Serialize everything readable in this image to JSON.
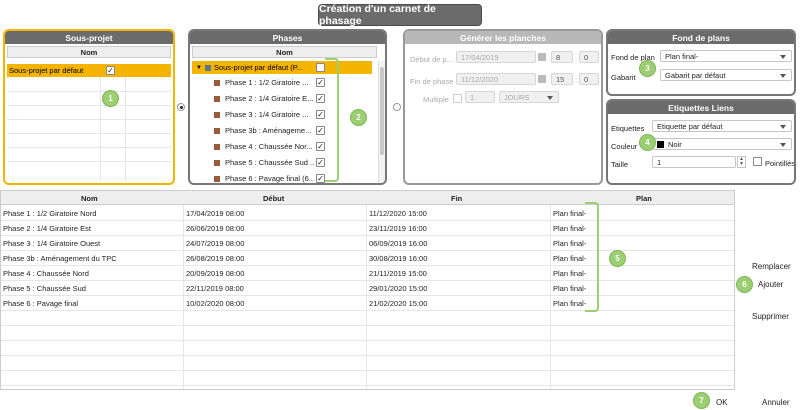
{
  "title": "Création d'un carnet de phasage",
  "sous_projet": {
    "title": "Sous-projet",
    "col_nom": "Nom",
    "rows": [
      {
        "label": "Sous-projet par défaut",
        "checked": true
      }
    ]
  },
  "phases": {
    "title": "Phases",
    "col_nom": "Nom",
    "parent": "Sous-projet par défaut (P...",
    "items": [
      "Phase 1 : 1/2 Giratoire ...",
      "Phase 2 : 1/4 Giratoire E...",
      "Phase 3 : 1/4 Giratoire ...",
      "Phase 3b : Aménageme...",
      "Phase 4 : Chaussée Nor...",
      "Phase 5 : Chaussée Sud ...",
      "Phase 6 : Pavage final (6..."
    ]
  },
  "generer": {
    "title": "Générer les planches",
    "debut_label": "Début de p...",
    "debut_date": "17/04/2019",
    "debut_h": "8",
    "debut_m": "0",
    "fin_label": "Fin de phase",
    "fin_date": "11/12/2020",
    "fin_h": "15",
    "fin_m": "0",
    "multiple_label": "Multiple",
    "multiple_value": "1",
    "unit": "JOURS"
  },
  "fond": {
    "title": "Fond de plans",
    "fond_label": "Fond de plan",
    "fond_value": "Plan final-",
    "gabarit_label": "Gabarit",
    "gabarit_value": "Gabarit par défaut"
  },
  "etiq": {
    "title": "Etiquettes Liens",
    "etiq_label": "Etiquettes",
    "etiq_value": "Etiquette par défaut",
    "couleur_label": "Couleur",
    "couleur_value": "Noir",
    "couleur_color": "#000000",
    "taille_label": "Taille",
    "taille_value": "1",
    "pointilles_label": "Pointillés"
  },
  "table": {
    "headers": [
      "Nom",
      "Début",
      "Fin",
      "Plan"
    ],
    "rows": [
      [
        "Phase 1 : 1/2 Giratoire Nord",
        "17/04/2019 08:00",
        "11/12/2020 15:00",
        "Plan final-"
      ],
      [
        "Phase 2 : 1/4 Giratoire Est",
        "26/06/2019 08:00",
        "23/11/2019 16:00",
        "Plan final-"
      ],
      [
        "Phase 3 : 1/4 Giratoire Ouest",
        "24/07/2019 08:00",
        "06/09/2019 16:00",
        "Plan final-"
      ],
      [
        "Phase 3b : Aménagement du TPC",
        "26/08/2019 08:00",
        "30/08/2019 16:00",
        "Plan final-"
      ],
      [
        "Phase 4 : Chaussée Nord",
        "20/09/2019 08:00",
        "21/11/2019 15:00",
        "Plan final-"
      ],
      [
        "Phase 5 : Chaussée Sud",
        "22/11/2019 08:00",
        "29/01/2020 15:00",
        "Plan final-"
      ],
      [
        "Phase 6 : Pavage final",
        "10/02/2020 08:00",
        "21/02/2020 15:00",
        "Plan final-"
      ]
    ]
  },
  "buttons": {
    "remplacer": "Remplacer",
    "ajouter": "Ajouter",
    "supprimer": "Supprimer",
    "ok": "OK",
    "annuler": "Annuler"
  },
  "badges": [
    "1",
    "2",
    "3",
    "4",
    "5",
    "6",
    "7"
  ],
  "colors": {
    "highlight": "#f4b400",
    "badge": "#9bcf72",
    "header": "#6b6b6b",
    "phase_icon": "#9c5a3c"
  }
}
